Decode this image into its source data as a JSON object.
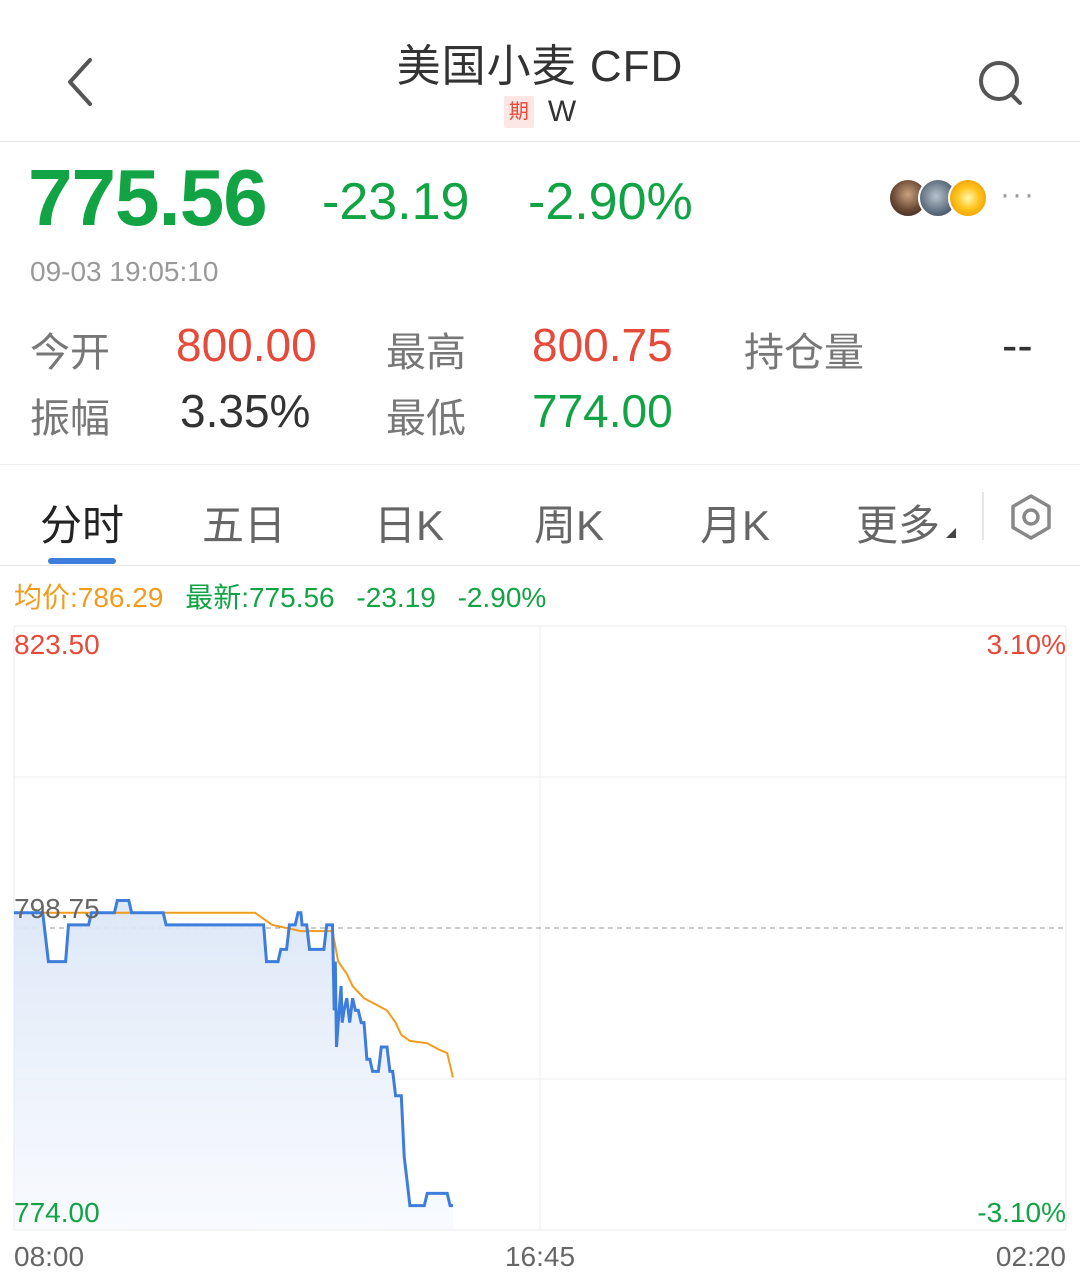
{
  "header": {
    "title": "美国小麦 CFD",
    "badge": "期",
    "symbol": "W"
  },
  "quote": {
    "price": "775.56",
    "change": "-23.19",
    "change_pct": "-2.90%",
    "timestamp": "09-03 19:05:10",
    "more": "···"
  },
  "stats": {
    "open_label": "今开",
    "open_value": "800.00",
    "high_label": "最高",
    "high_value": "800.75",
    "oi_label": "持仓量",
    "oi_value": "--",
    "amp_label": "振幅",
    "amp_value": "3.35%",
    "low_label": "最低",
    "low_value": "774.00"
  },
  "tabs": [
    "分时",
    "五日",
    "日K",
    "周K",
    "月K",
    "更多"
  ],
  "summary": {
    "avg": "均价:786.29",
    "latest": "最新:775.56",
    "change": "-23.19",
    "pct": "-2.90%"
  },
  "colors": {
    "up": "#e64a3b",
    "down": "#12a345",
    "price_line": "#3d7ddb",
    "avg_line": "#f29b1d",
    "accent": "#3d7ddb"
  },
  "chart_data": {
    "type": "line",
    "y_top_label": "823.50",
    "y_mid_label": "798.75",
    "y_bottom_label": "774.00",
    "pct_top_label": "3.10%",
    "pct_bottom_label": "-3.10%",
    "x_labels": [
      "08:00",
      "16:45",
      "02:20"
    ],
    "ylim": [
      774.0,
      823.5
    ],
    "reference": 798.75,
    "series": [
      {
        "values": [
          [
            0,
            800
          ],
          [
            0.5,
            800
          ],
          [
            0.6,
            796
          ],
          [
            0.9,
            796
          ],
          [
            0.95,
            799
          ],
          [
            1.3,
            799
          ],
          [
            1.35,
            800
          ],
          [
            1.75,
            800
          ],
          [
            1.8,
            801
          ],
          [
            2.0,
            801
          ],
          [
            2.05,
            800
          ],
          [
            2.6,
            800
          ],
          [
            2.65,
            799
          ],
          [
            4.35,
            799
          ],
          [
            4.4,
            796
          ],
          [
            4.6,
            796
          ],
          [
            4.65,
            797
          ],
          [
            4.75,
            797
          ],
          [
            4.8,
            799
          ],
          [
            4.9,
            799
          ],
          [
            4.95,
            800
          ],
          [
            5.0,
            800
          ],
          [
            5.02,
            799
          ],
          [
            5.1,
            799
          ],
          [
            5.15,
            797
          ],
          [
            5.4,
            797
          ],
          [
            5.45,
            799
          ],
          [
            5.55,
            799
          ],
          [
            5.58,
            792
          ],
          [
            5.6,
            796
          ],
          [
            5.62,
            789
          ],
          [
            5.65,
            791
          ],
          [
            5.7,
            794
          ],
          [
            5.72,
            791
          ],
          [
            5.75,
            792
          ],
          [
            5.8,
            793
          ],
          [
            5.85,
            791
          ],
          [
            5.9,
            793
          ],
          [
            5.95,
            792
          ],
          [
            6.0,
            792
          ],
          [
            6.05,
            791
          ],
          [
            6.1,
            791
          ],
          [
            6.15,
            788
          ],
          [
            6.2,
            788
          ],
          [
            6.25,
            787
          ],
          [
            6.35,
            787
          ],
          [
            6.4,
            789
          ],
          [
            6.5,
            789
          ],
          [
            6.55,
            787
          ],
          [
            6.6,
            787
          ],
          [
            6.65,
            785
          ],
          [
            6.75,
            785
          ],
          [
            6.8,
            780
          ],
          [
            6.85,
            778
          ],
          [
            6.9,
            776
          ],
          [
            7.15,
            776
          ],
          [
            7.2,
            777
          ],
          [
            7.35,
            777
          ],
          [
            7.45,
            777
          ],
          [
            7.55,
            777
          ],
          [
            7.6,
            776
          ],
          [
            7.65,
            776
          ]
        ]
      },
      {
        "values": [
          [
            0,
            800
          ],
          [
            3.35,
            800
          ],
          [
            4.2,
            800
          ],
          [
            4.5,
            799
          ],
          [
            5.0,
            798.5
          ],
          [
            5.55,
            798.5
          ],
          [
            5.65,
            796
          ],
          [
            5.8,
            795
          ],
          [
            5.9,
            794
          ],
          [
            6.1,
            793
          ],
          [
            6.3,
            792.5
          ],
          [
            6.5,
            792
          ],
          [
            6.65,
            791
          ],
          [
            6.75,
            790
          ],
          [
            6.9,
            789.5
          ],
          [
            7.2,
            789.3
          ],
          [
            7.4,
            788.8
          ],
          [
            7.55,
            788.5
          ],
          [
            7.6,
            787.5
          ],
          [
            7.65,
            786.5
          ]
        ]
      }
    ],
    "x_range_hours": [
      0,
      18.333
    ],
    "grid": true
  }
}
